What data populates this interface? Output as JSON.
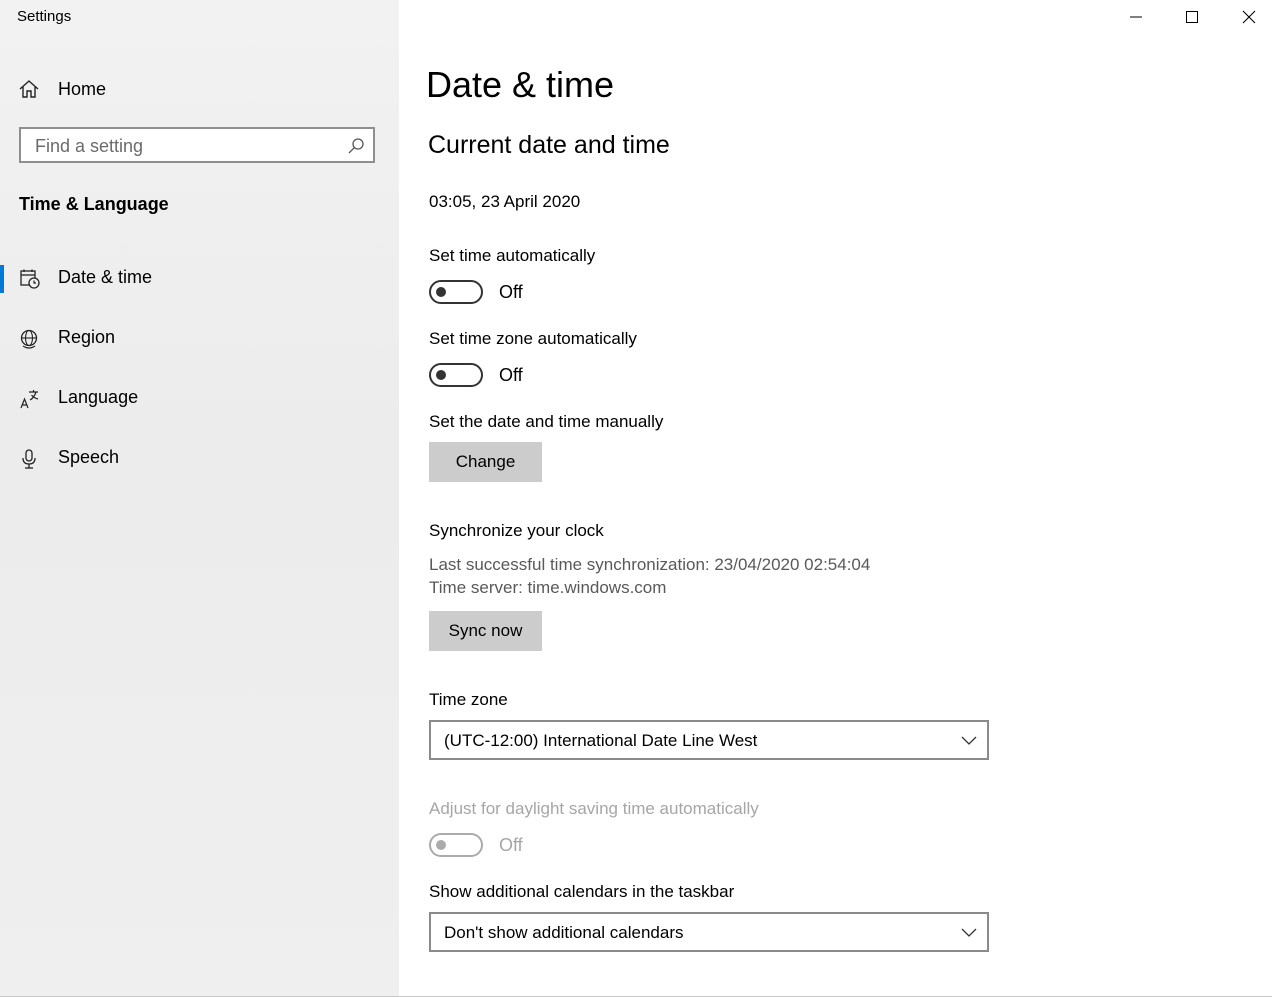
{
  "window": {
    "title": "Settings"
  },
  "sidebar": {
    "home_label": "Home",
    "search_placeholder": "Find a setting",
    "section_title": "Time & Language",
    "items": [
      {
        "label": "Date & time",
        "icon": "calendar-clock-icon",
        "selected": true
      },
      {
        "label": "Region",
        "icon": "globe-icon",
        "selected": false
      },
      {
        "label": "Language",
        "icon": "language-icon",
        "selected": false
      },
      {
        "label": "Speech",
        "icon": "microphone-icon",
        "selected": false
      }
    ],
    "accent_color": "#0078d7"
  },
  "main": {
    "page_title": "Date & time",
    "section_title": "Current date and time",
    "current_datetime": "03:05, 23 April 2020",
    "set_time_auto": {
      "label": "Set time automatically",
      "state": "Off"
    },
    "set_timezone_auto": {
      "label": "Set time zone automatically",
      "state": "Off"
    },
    "manual": {
      "label": "Set the date and time manually",
      "button": "Change"
    },
    "sync": {
      "title": "Synchronize your clock",
      "last_sync": "Last successful time synchronization: 23/04/2020 02:54:04",
      "server": "Time server: time.windows.com",
      "button": "Sync now"
    },
    "timezone": {
      "label": "Time zone",
      "value": "(UTC-12:00) International Date Line West"
    },
    "dst": {
      "label": "Adjust for daylight saving time automatically",
      "state": "Off"
    },
    "calendars": {
      "label": "Show additional calendars in the taskbar",
      "value": "Don't show additional calendars"
    }
  }
}
